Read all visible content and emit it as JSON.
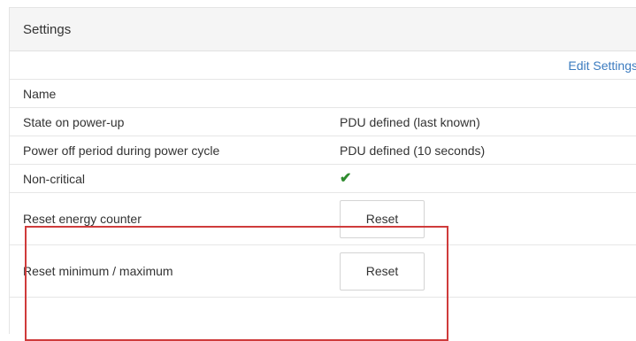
{
  "panel": {
    "title": "Settings",
    "edit_link": "Edit Settings"
  },
  "rows": [
    {
      "label": "Name",
      "value": ""
    },
    {
      "label": "State on power-up",
      "value": "PDU defined (last known)"
    },
    {
      "label": "Power off period during power cycle",
      "value": "PDU defined (10 seconds)"
    },
    {
      "label": "Non-critical",
      "value_icon": "checkmark-icon"
    }
  ],
  "actions": [
    {
      "label": "Reset energy counter",
      "button": "Reset"
    },
    {
      "label": "Reset minimum / maximum",
      "button": "Reset"
    }
  ],
  "colors": {
    "link": "#3b7bbf",
    "check": "#2e8b2e",
    "highlight": "#cf3b3b"
  }
}
